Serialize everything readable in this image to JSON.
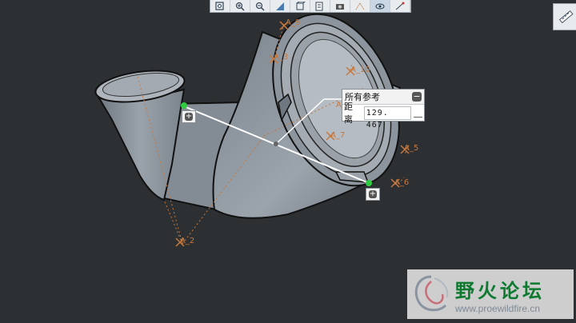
{
  "toolbar": {
    "icons": [
      "zoom-fit-icon",
      "zoom-in-icon",
      "zoom-out-icon",
      "repaint-icon",
      "view-orient-icon",
      "saved-views-icon",
      "display-style-icon",
      "datum-display-icon",
      "spin-center-icon",
      "annotation-icon"
    ]
  },
  "datums": {
    "a2": "A_2",
    "a3": "A_3",
    "a4": "A_4",
    "a5": "A_5",
    "a6": "A_6",
    "a7": "A_7",
    "a9": "A_9",
    "a10": "A_10"
  },
  "measure": {
    "header": "所有参考",
    "distance_label": "距离",
    "distance_value": "129. 467"
  },
  "watermark": {
    "title": "野火论坛",
    "url": "www.proewildfire.cn"
  },
  "colors": {
    "background": "#2d3032",
    "model": "#8d959f",
    "datum": "#c8783c",
    "logo_green": "#0e7a2f"
  }
}
